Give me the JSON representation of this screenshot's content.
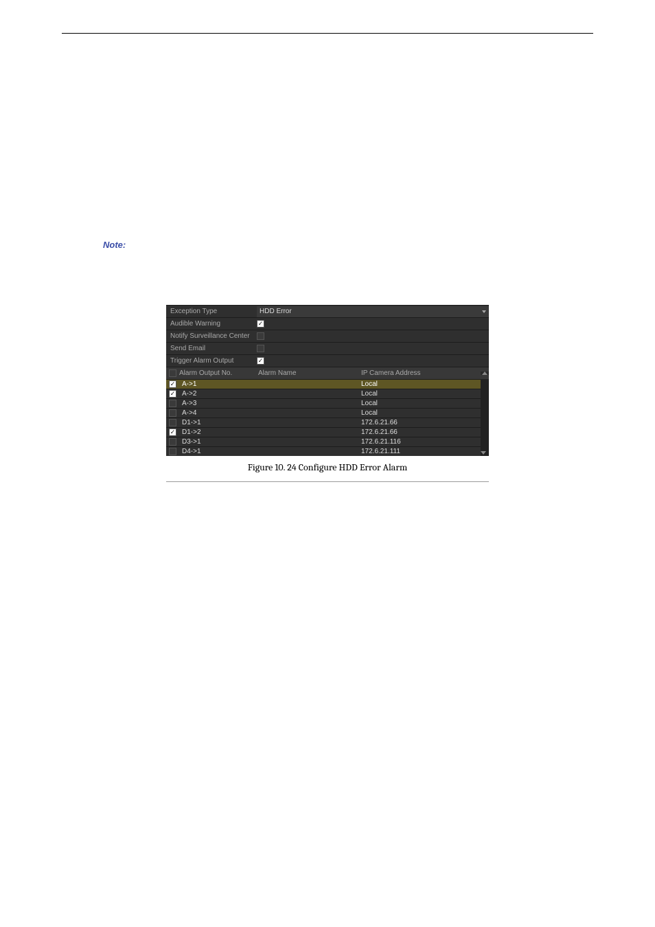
{
  "note_label": "Note:",
  "panel": {
    "exception_type_label": "Exception Type",
    "exception_type_value": "HDD Error",
    "options": [
      {
        "label": "Audible Warning",
        "checked": true
      },
      {
        "label": "Notify Surveillance Center",
        "checked": false
      },
      {
        "label": "Send Email",
        "checked": false
      },
      {
        "label": "Trigger Alarm Output",
        "checked": true
      }
    ],
    "table": {
      "headers": {
        "no": "Alarm Output No.",
        "name": "Alarm Name",
        "addr": "IP Camera Address"
      },
      "rows": [
        {
          "checked": true,
          "no": "A->1",
          "name": "",
          "addr": "Local",
          "selected": true
        },
        {
          "checked": true,
          "no": "A->2",
          "name": "",
          "addr": "Local",
          "selected": false
        },
        {
          "checked": false,
          "no": "A->3",
          "name": "",
          "addr": "Local",
          "selected": false
        },
        {
          "checked": false,
          "no": "A->4",
          "name": "",
          "addr": "Local",
          "selected": false
        },
        {
          "checked": false,
          "no": "D1->1",
          "name": "",
          "addr": "172.6.21.66",
          "selected": false
        },
        {
          "checked": true,
          "no": "D1->2",
          "name": "",
          "addr": "172.6.21.66",
          "selected": false
        },
        {
          "checked": false,
          "no": "D3->1",
          "name": "",
          "addr": "172.6.21.116",
          "selected": false
        },
        {
          "checked": false,
          "no": "D4->1",
          "name": "",
          "addr": "172.6.21.111",
          "selected": false
        }
      ]
    }
  },
  "caption": "Figure 10. 24 Configure HDD Error Alarm"
}
